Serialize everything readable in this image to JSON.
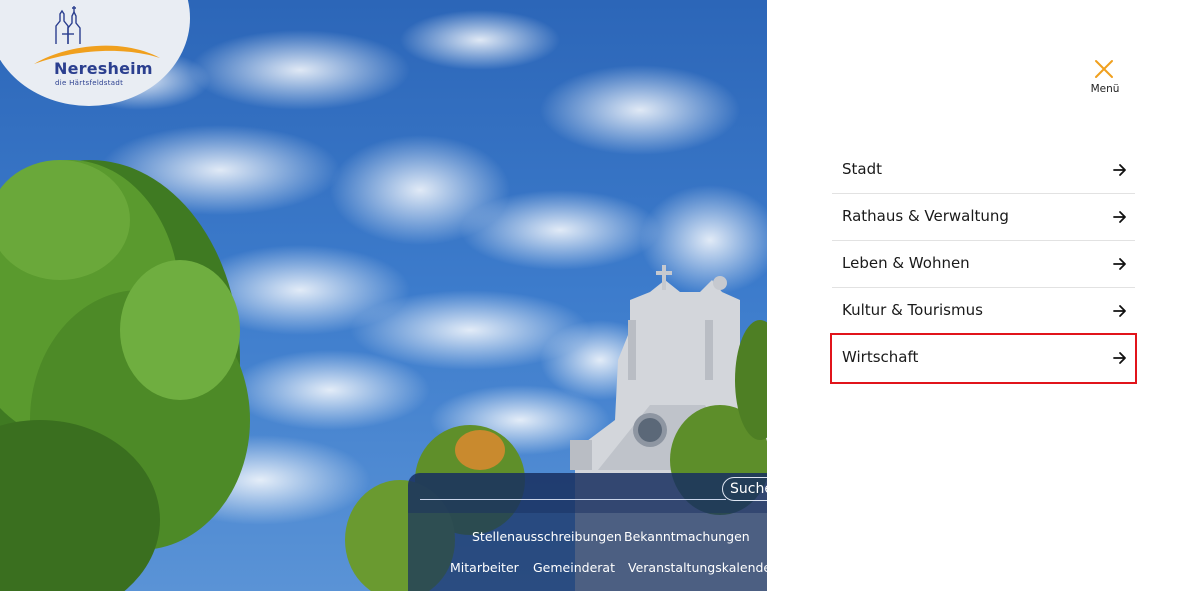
{
  "logo": {
    "name": "Neresheim",
    "subtitle": "die Härtsfeldstadt"
  },
  "search": {
    "button_label": "Suche"
  },
  "quick_links": [
    "Stellenausschreibungen",
    "Bekanntmachungen",
    "Mitarbeiter",
    "Gemeinderat",
    "Veranstaltungskalender"
  ],
  "menu": {
    "close_label": "Menü",
    "items": [
      "Stadt",
      "Rathaus & Verwaltung",
      "Leben & Wohnen",
      "Kultur & Tourismus",
      "Wirtschaft"
    ],
    "highlighted_item": "Wirtschaft"
  },
  "colors": {
    "accent": "#f0a01e",
    "brand": "#2b3f8f",
    "highlight_border": "#e1141b",
    "panel": "#183060"
  }
}
